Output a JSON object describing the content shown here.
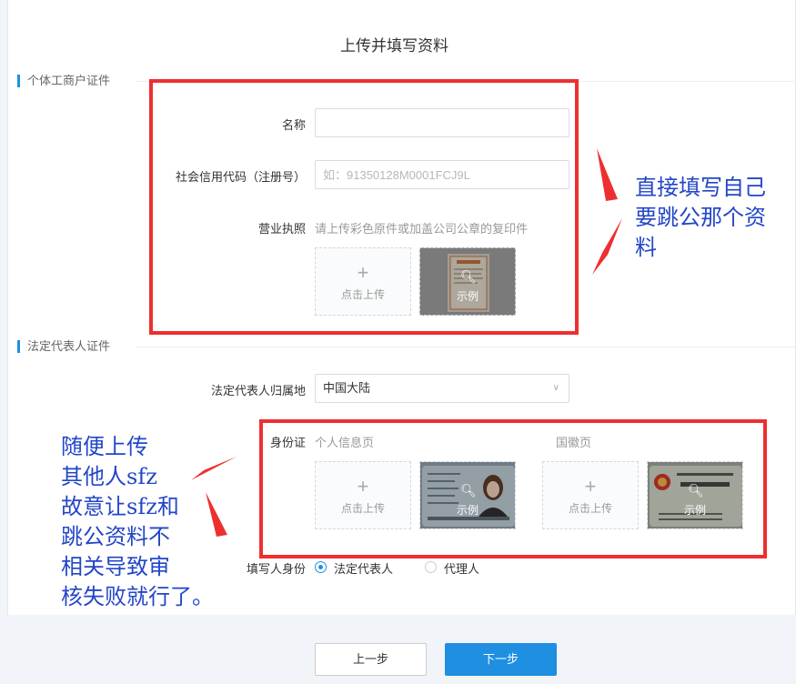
{
  "page": {
    "title": "上传并填写资料"
  },
  "section_business": {
    "title": "个体工商户证件",
    "name_label": "名称",
    "name_value": "",
    "credit_label": "社会信用代码（注册号）",
    "credit_placeholder": "如：91350128M0001FCJ9L",
    "license_label": "营业执照",
    "license_hint": "请上传彩色原件或加盖公司公章的复印件",
    "upload_plus": "+",
    "upload_text": "点击上传",
    "sample_text": "示例"
  },
  "section_legal": {
    "title": "法定代表人证件",
    "region_label": "法定代表人归属地",
    "region_value": "中国大陆",
    "id_label": "身份证",
    "id_front_label": "个人信息页",
    "id_back_label": "国徽页",
    "upload_plus": "+",
    "upload_text": "点击上传",
    "sample_text": "示例",
    "filler_label": "填写人身份",
    "filler_options": [
      "法定代表人",
      "代理人"
    ],
    "filler_selected": "法定代表人"
  },
  "footer": {
    "prev_label": "上一步",
    "next_label": "下一步"
  },
  "annotations": {
    "right_note": [
      "直接填写自己",
      "要跳公那个资",
      "料"
    ],
    "left_note": [
      "随便上传",
      "其他人sfz",
      "故意让sfz和",
      "跳公资料不",
      "相关导致审",
      "核失败就行了。"
    ]
  },
  "colors": {
    "accent": "#1e8fe1",
    "annotation_box": "#ee2f2f",
    "annotation_text": "#2346c9"
  }
}
